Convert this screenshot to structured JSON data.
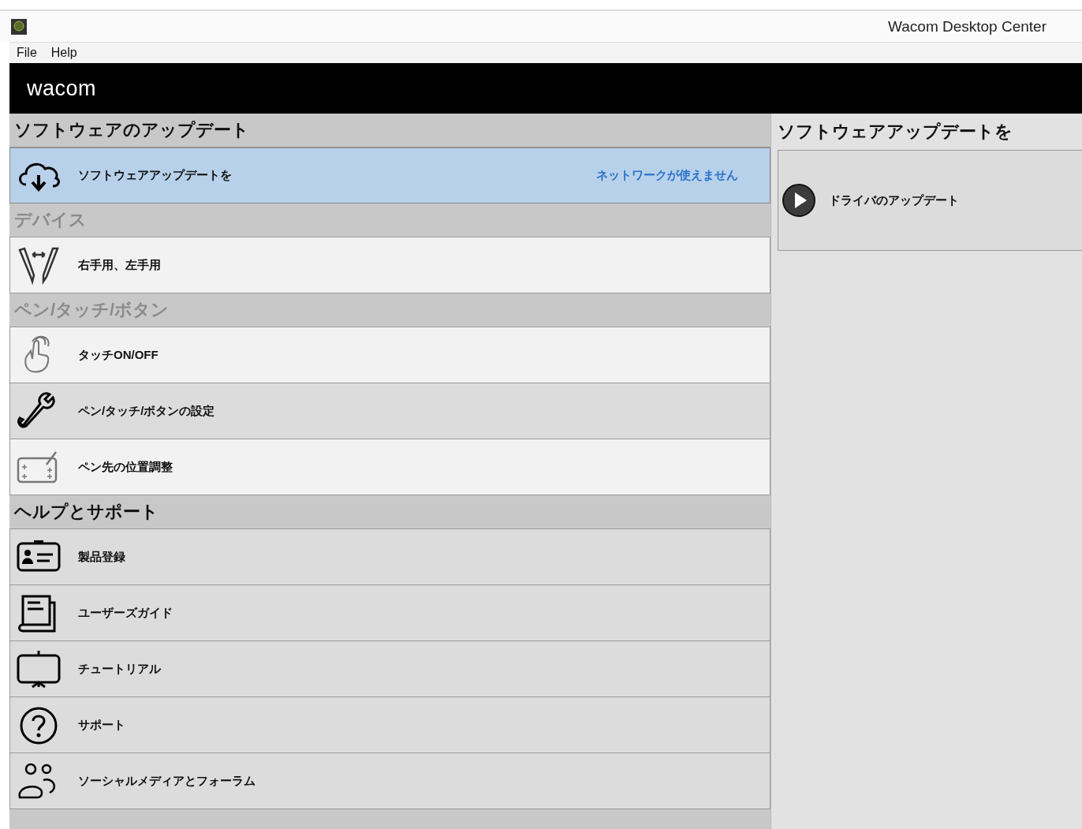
{
  "window": {
    "title": "Wacom Desktop Center"
  },
  "menu": [
    "File",
    "Help"
  ],
  "brand": {
    "logo": "wacom"
  },
  "sections": [
    {
      "title": "ソフトウェアのアップデート",
      "disabled": false,
      "items": [
        {
          "label": "ソフトウェアアップデートを",
          "status": "ネットワークが使えません",
          "selected": true,
          "color": "#b8d1ea"
        }
      ]
    },
    {
      "title": "デバイス",
      "disabled": true,
      "items": [
        {
          "label": "右手用、左手用",
          "selected": false,
          "color": "#f2f2f2"
        }
      ]
    },
    {
      "title": "ペン/タッチ/ボタン",
      "disabled": true,
      "items": [
        {
          "label": "タッチON/OFF",
          "selected": false,
          "color": "#f2f2f2"
        },
        {
          "label": "ペン/タッチ/ボタンの設定",
          "selected": false,
          "color": "#dcdcdc"
        },
        {
          "label": "ペン先の位置調整",
          "selected": false,
          "color": "#f2f2f2"
        }
      ]
    },
    {
      "title": "ヘルプとサポート",
      "disabled": false,
      "items": [
        {
          "label": "製品登録",
          "selected": false,
          "color": "#dcdcdc"
        },
        {
          "label": "ユーザーズガイド",
          "selected": false,
          "color": "#dcdcdc"
        },
        {
          "label": "チュートリアル",
          "selected": false,
          "color": "#dcdcdc"
        },
        {
          "label": "サポート",
          "selected": false,
          "color": "#dcdcdc"
        },
        {
          "label": "ソーシャルメディアとフォーラム",
          "selected": false,
          "color": "#dcdcdc"
        }
      ]
    }
  ],
  "detail": {
    "title": "ソフトウェアアップデートを",
    "actions": [
      {
        "label": "ドライバのアップデート"
      }
    ]
  }
}
